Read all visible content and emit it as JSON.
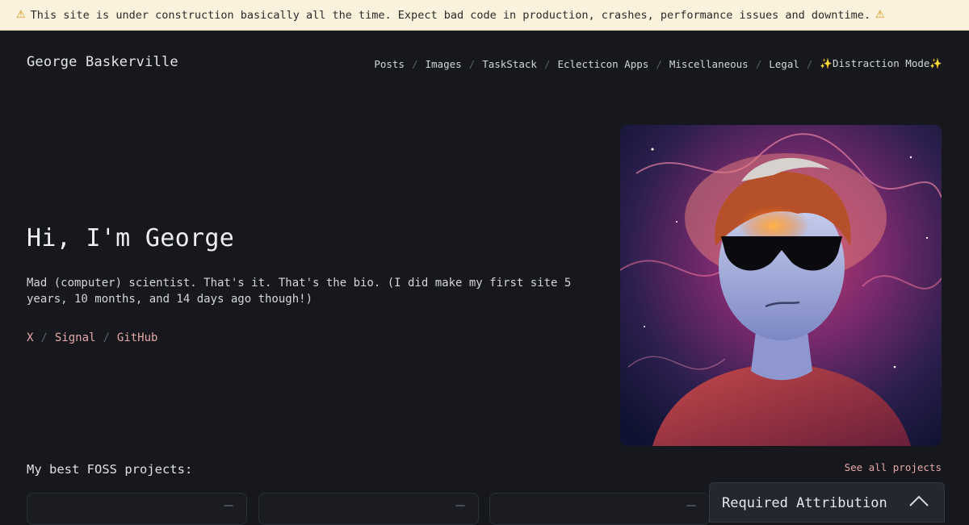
{
  "banner": {
    "icon": "warning-icon",
    "text": "This site is under construction basically all the time. Expect bad code in production, crashes, performance issues and downtime."
  },
  "header": {
    "site_title": "George Baskerville",
    "nav": [
      {
        "label": "Posts"
      },
      {
        "label": "Images"
      },
      {
        "label": "TaskStack"
      },
      {
        "label": "Eclecticon Apps"
      },
      {
        "label": "Miscellaneous"
      },
      {
        "label": "Legal"
      },
      {
        "label": "Distraction Mode",
        "icon": "sparkles-icon"
      }
    ]
  },
  "hero": {
    "title": "Hi, I'm George",
    "bio": "Mad (computer) scientist. That's it. That's the bio. (I did make my first site 5 years, 10 months, and 14 days ago though!)",
    "socials": [
      {
        "label": "X"
      },
      {
        "label": "Signal"
      },
      {
        "label": "GitHub"
      }
    ]
  },
  "projects": {
    "title": "My best FOSS projects:",
    "see_all": "See all projects"
  },
  "attribution": {
    "label": "Required Attribution",
    "icon": "chevron-up-icon"
  },
  "colors": {
    "background": "#16181d",
    "banner_bg": "#fbf2de",
    "link_accent": "#e7a7a7"
  }
}
